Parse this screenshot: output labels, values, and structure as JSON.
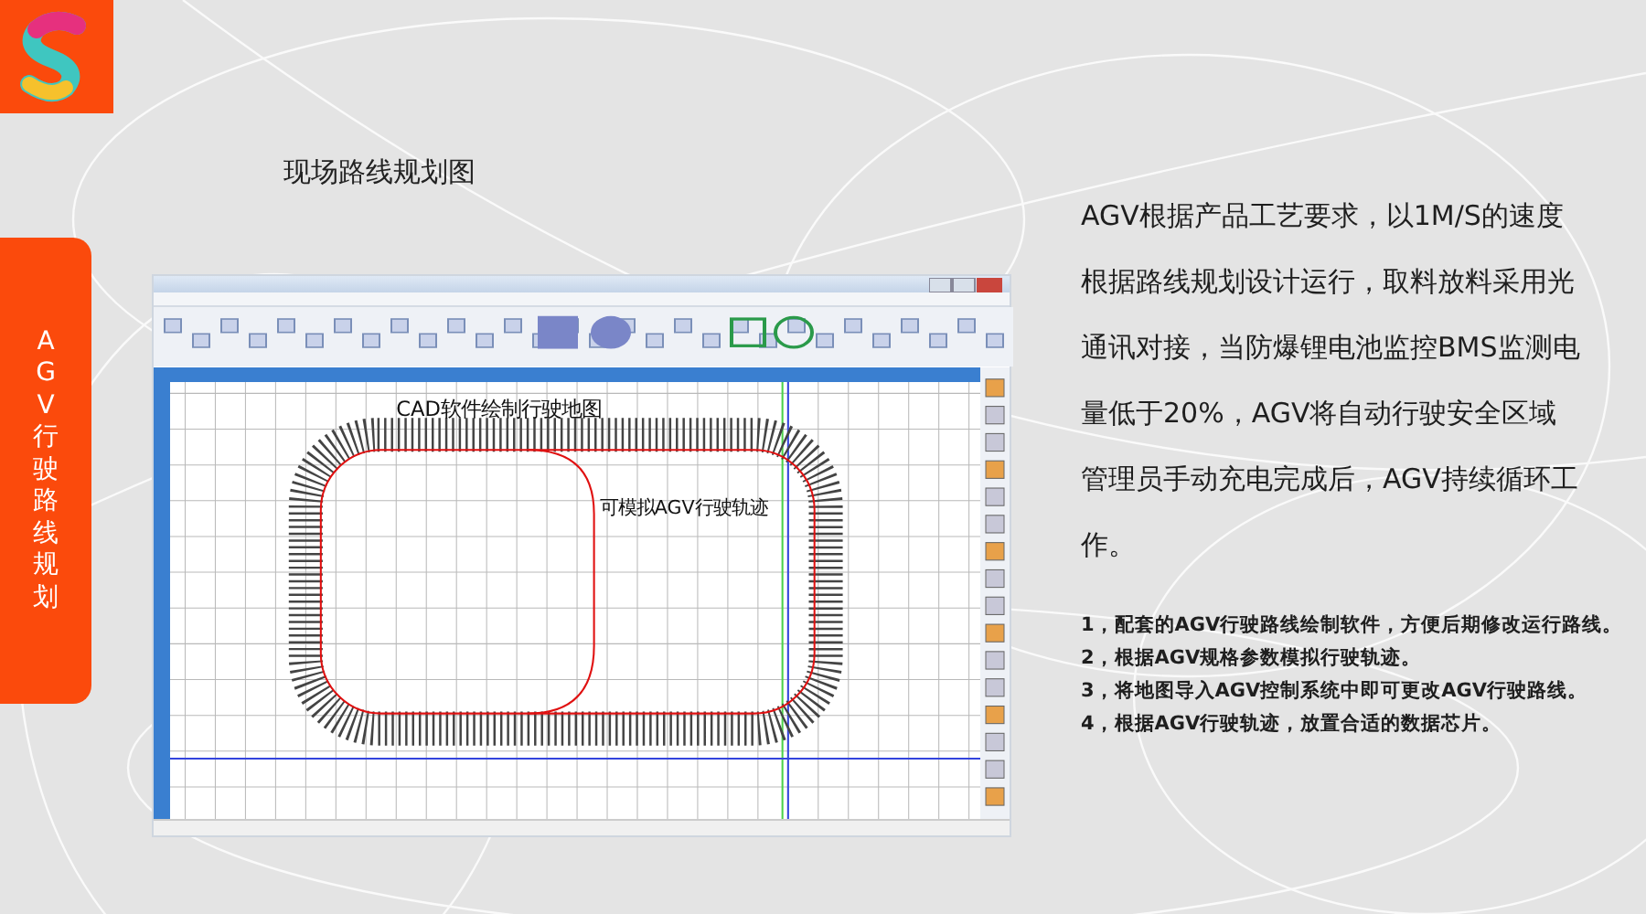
{
  "sidebar": {
    "label": "AGV行驶路线规划"
  },
  "title": "现场路线规划图",
  "cad_screenshot": {
    "labels": [
      {
        "kind": "heading",
        "text": "CAD软件绘制行驶地图"
      },
      {
        "kind": "note",
        "text": "可模拟AGV行驶轨迹"
      }
    ]
  },
  "description": "AGV根据产品工艺要求，以1M/S的速度根据路线规划设计运行，取料放料采用光通讯对接，当防爆锂电池监控BMS监测电量低于20%，AGV将自动行驶安全区域管理员手动充电完成后，AGV持续循环工作。",
  "steps": [
    "1，配套的AGV行驶路线绘制软件，方便后期修改运行路线。",
    "2，根据AGV规格参数模拟行驶轨迹。",
    "3，将地图导入AGV控制系统中即可更改AGV行驶路线。",
    "4，根据AGV行驶轨迹，放置合适的数据芯片。"
  ]
}
